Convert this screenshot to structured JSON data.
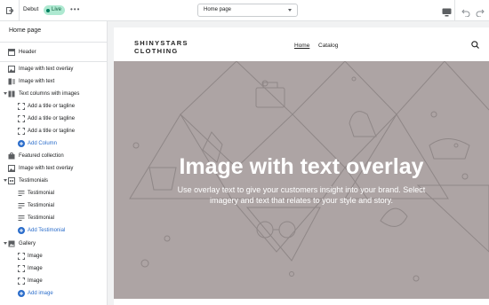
{
  "topbar": {
    "theme_name": "Debut",
    "status_badge": "Live",
    "more_label": "•••",
    "page_select": "Home page"
  },
  "sidebar": {
    "title": "Home page",
    "items": [
      {
        "label": "Header",
        "icon": "header-icon"
      },
      {
        "label": "Image with text overlay",
        "icon": "image-overlay-icon"
      },
      {
        "label": "Image with text",
        "icon": "image-text-icon"
      },
      {
        "label": "Text columns with images",
        "icon": "columns-icon"
      },
      {
        "label": "Add a title or tagline",
        "icon": "drag-handle-icon"
      },
      {
        "label": "Add a title or tagline",
        "icon": "drag-handle-icon"
      },
      {
        "label": "Add a title or tagline",
        "icon": "drag-handle-icon"
      },
      {
        "label": "Add Column",
        "icon": "plus-circle-icon"
      },
      {
        "label": "Featured collection",
        "icon": "collection-icon"
      },
      {
        "label": "Image with text overlay",
        "icon": "image-overlay-icon"
      },
      {
        "label": "Testimonials",
        "icon": "quote-icon"
      },
      {
        "label": "Testimonial",
        "icon": "drag-handle-icon"
      },
      {
        "label": "Testimonial",
        "icon": "drag-handle-icon"
      },
      {
        "label": "Testimonial",
        "icon": "drag-handle-icon"
      },
      {
        "label": "Add Testimonial",
        "icon": "plus-circle-icon"
      },
      {
        "label": "Gallery",
        "icon": "gallery-icon"
      },
      {
        "label": "Image",
        "icon": "drag-handle-icon"
      },
      {
        "label": "Image",
        "icon": "drag-handle-icon"
      },
      {
        "label": "Image",
        "icon": "drag-handle-icon"
      },
      {
        "label": "Add image",
        "icon": "plus-circle-icon"
      }
    ]
  },
  "preview": {
    "logo_line1": "SHINYSTARS",
    "logo_line2": "CLOTHING",
    "nav": [
      "Home",
      "Catalog"
    ],
    "hero_title": "Image with text overlay",
    "hero_text": "Use overlay text to give your customers insight into your brand. Select imagery and text that relates to your style and story.",
    "hero_color": "#ada4a4"
  },
  "colors": {
    "link_blue": "#2c6ecb",
    "live_badge": "#aee9d1"
  }
}
